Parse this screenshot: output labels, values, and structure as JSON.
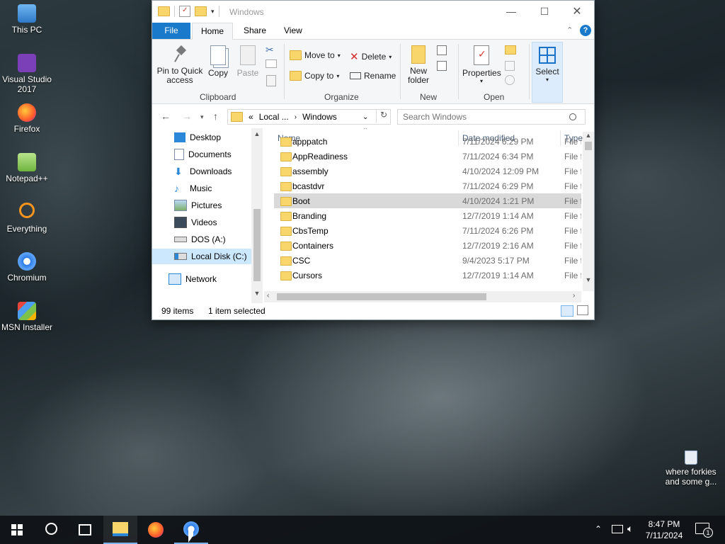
{
  "desktop": {
    "icons": [
      {
        "label": "This PC"
      },
      {
        "label": "Visual Studio 2017"
      },
      {
        "label": "Firefox"
      },
      {
        "label": "Notepad++"
      },
      {
        "label": "Everything"
      },
      {
        "label": "Chromium"
      },
      {
        "label": "MSN Installer"
      },
      {
        "label": "where forkies and some g..."
      }
    ]
  },
  "window": {
    "title": "Windows",
    "tabs": {
      "file": "File",
      "home": "Home",
      "share": "Share",
      "view": "View"
    },
    "ribbon": {
      "pin": "Pin to Quick access",
      "copy": "Copy",
      "paste": "Paste",
      "clipboard": "Clipboard",
      "move_to": "Move to",
      "copy_to": "Copy to",
      "delete": "Delete",
      "rename": "Rename",
      "organize": "Organize",
      "new_folder": "New folder",
      "new": "New",
      "properties": "Properties",
      "open": "Open",
      "select": "Select"
    },
    "address": {
      "prefix": "«",
      "crumb1": "Local ...",
      "crumb2": "Windows"
    },
    "search": {
      "placeholder": "Search Windows"
    },
    "nav": [
      {
        "label": "Desktop"
      },
      {
        "label": "Documents"
      },
      {
        "label": "Downloads"
      },
      {
        "label": "Music"
      },
      {
        "label": "Pictures"
      },
      {
        "label": "Videos"
      },
      {
        "label": "DOS (A:)"
      },
      {
        "label": "Local Disk (C:)"
      },
      {
        "label": "Network"
      }
    ],
    "columns": {
      "name": "Name",
      "date": "Date modified",
      "type": "Type"
    },
    "files": [
      {
        "name": "apppatch",
        "date": "7/11/2024 6:29 PM",
        "type": "File f"
      },
      {
        "name": "AppReadiness",
        "date": "7/11/2024 6:34 PM",
        "type": "File f"
      },
      {
        "name": "assembly",
        "date": "4/10/2024 12:09 PM",
        "type": "File f"
      },
      {
        "name": "bcastdvr",
        "date": "7/11/2024 6:29 PM",
        "type": "File f"
      },
      {
        "name": "Boot",
        "date": "4/10/2024 1:21 PM",
        "type": "File f"
      },
      {
        "name": "Branding",
        "date": "12/7/2019 1:14 AM",
        "type": "File f"
      },
      {
        "name": "CbsTemp",
        "date": "7/11/2024 6:26 PM",
        "type": "File f"
      },
      {
        "name": "Containers",
        "date": "12/7/2019 2:16 AM",
        "type": "File f"
      },
      {
        "name": "CSC",
        "date": "9/4/2023 5:17 PM",
        "type": "File f"
      },
      {
        "name": "Cursors",
        "date": "12/7/2019 1:14 AM",
        "type": "File f"
      }
    ],
    "status": {
      "count": "99 items",
      "selected": "1 item selected"
    }
  },
  "taskbar": {
    "time": "8:47 PM",
    "date": "7/11/2024",
    "notifications": "1"
  },
  "colors": {
    "accent": "#1979ca",
    "selection": "#cce8ff",
    "folder": "#f8d66b"
  }
}
